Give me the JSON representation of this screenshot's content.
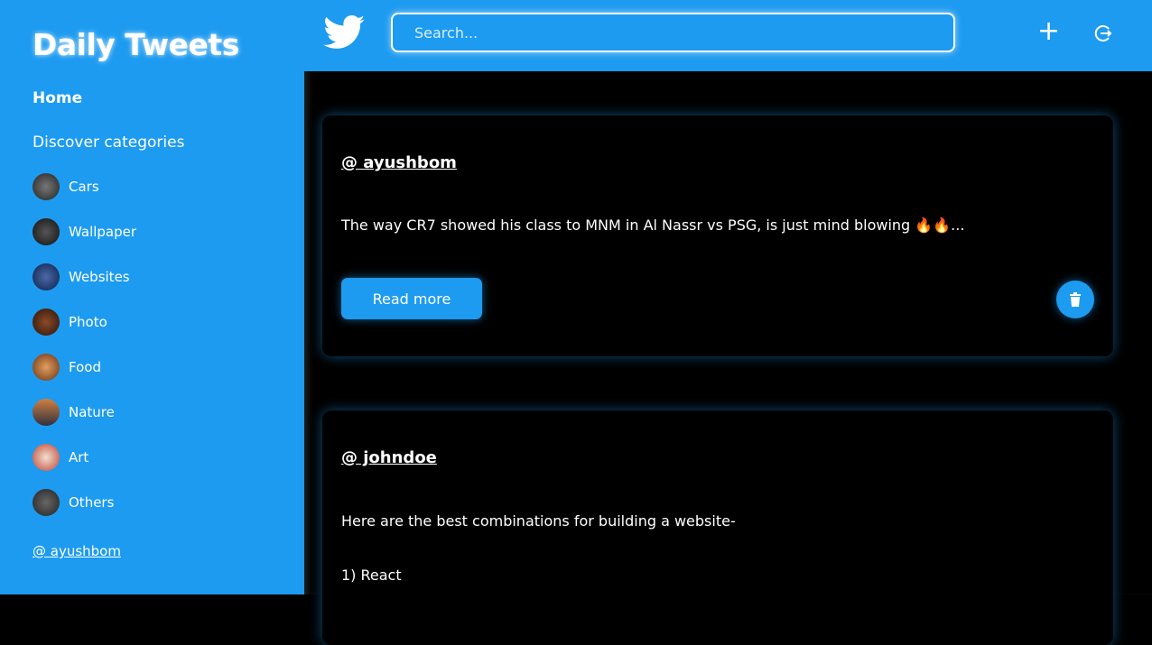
{
  "app": {
    "title": "Daily Tweets"
  },
  "colors": {
    "accent": "#1d9bf0",
    "background": "#000000"
  },
  "sidebar": {
    "home": "Home",
    "discover": "Discover categories",
    "categories": [
      {
        "label": "Cars"
      },
      {
        "label": "Wallpaper"
      },
      {
        "label": "Websites"
      },
      {
        "label": "Photo"
      },
      {
        "label": "Food"
      },
      {
        "label": "Nature"
      },
      {
        "label": "Art"
      },
      {
        "label": "Others"
      }
    ],
    "user": "@ ayushbom"
  },
  "header": {
    "logo_icon": "twitter-bird-icon",
    "search_placeholder": "Search...",
    "add_icon": "plus-icon",
    "logout_icon": "logout-icon"
  },
  "tweets": [
    {
      "handle": "@ ayushbom",
      "lines": [
        "The way CR7 showed his class to MNM in Al Nassr vs PSG, is just mind blowing 🔥🔥..."
      ],
      "read_more": "Read more"
    },
    {
      "handle": "@ johndoe",
      "lines": [
        "Here are the best combinations for building a website-",
        "1) React"
      ]
    }
  ]
}
